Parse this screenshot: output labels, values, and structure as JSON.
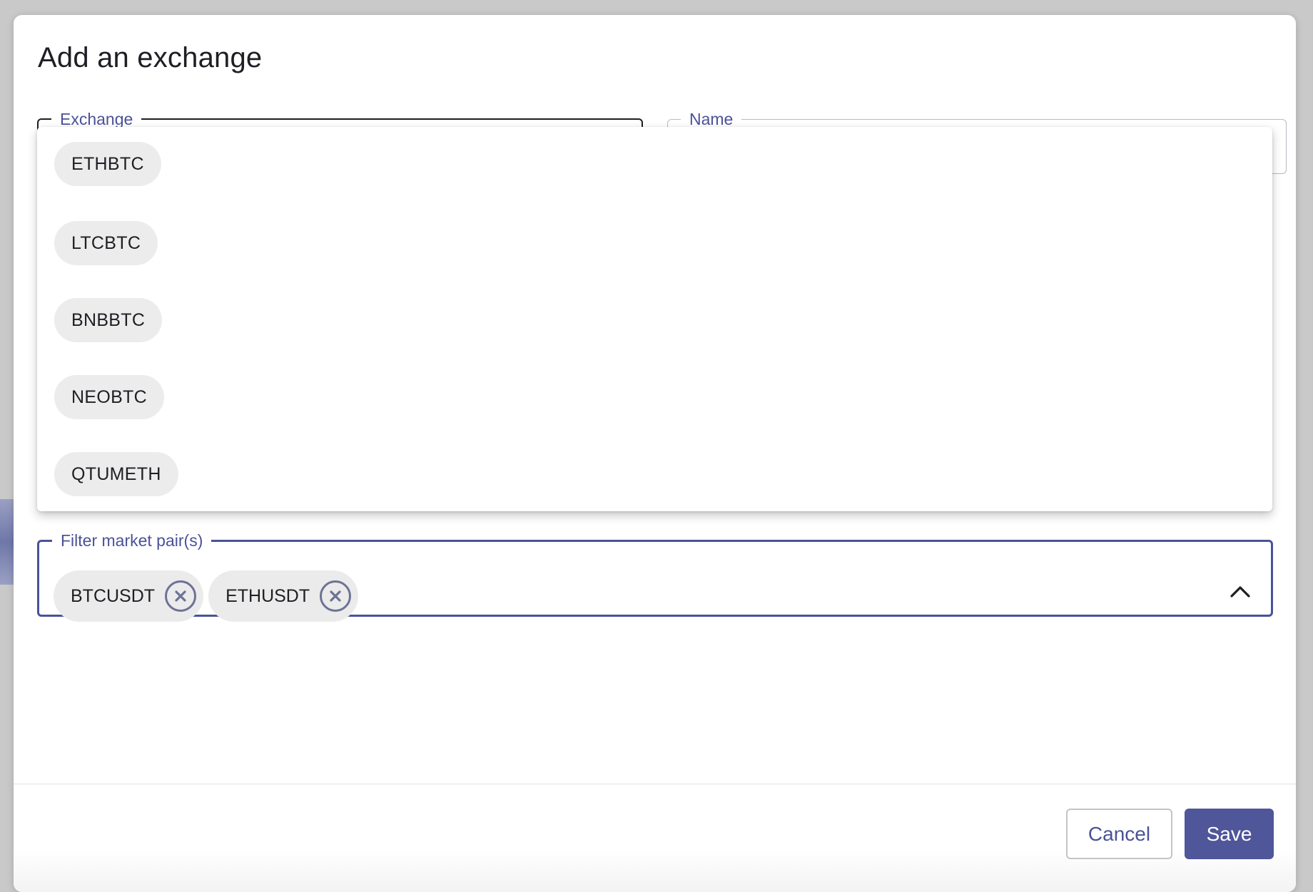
{
  "dialog": {
    "title": "Add an exchange"
  },
  "fields": {
    "exchange_label": "Exchange",
    "name_label": "Name",
    "filter_label": "Filter market pair(s)"
  },
  "dropdown": {
    "options": [
      "ETHBTC",
      "LTCBTC",
      "BNBBTC",
      "NEOBTC",
      "QTUMETH"
    ]
  },
  "filter": {
    "selected": [
      "BTCUSDT",
      "ETHUSDT"
    ]
  },
  "footer": {
    "cancel_label": "Cancel",
    "save_label": "Save"
  },
  "colors": {
    "accent": "#4f5699",
    "label": "#4b5298",
    "chip_bg": "#ebebeb"
  },
  "icons": {
    "remove": "close-circle-icon",
    "toggle": "chevron-up-icon"
  }
}
